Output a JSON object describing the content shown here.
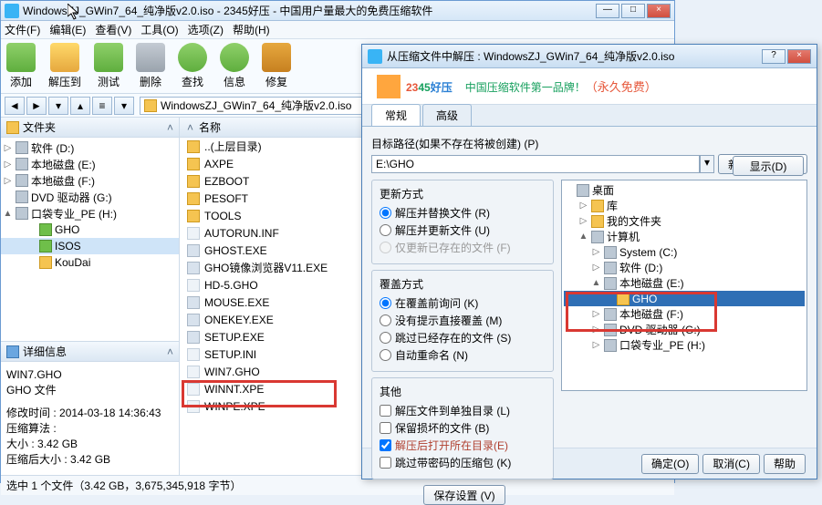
{
  "main": {
    "title": "WindowsZJ_GWin7_64_纯净版v2.0.iso - 2345好压 - 中国用户量最大的免费压缩软件",
    "menus": [
      "文件(F)",
      "编辑(E)",
      "查看(V)",
      "工具(O)",
      "选项(Z)",
      "帮助(H)"
    ],
    "toolbar": {
      "add": "添加",
      "extract": "解压到",
      "test": "测试",
      "del": "删除",
      "find": "查找",
      "info": "信息",
      "repair": "修复"
    },
    "navpath": "WindowsZJ_GWin7_64_纯净版v2.0.iso",
    "folderPane": "文件夹",
    "tree": [
      {
        "label": "软件 (D:)",
        "depth": 0,
        "exp": "▷",
        "ico": "drive"
      },
      {
        "label": "本地磁盘 (E:)",
        "depth": 0,
        "exp": "▷",
        "ico": "drive"
      },
      {
        "label": "本地磁盘 (F:)",
        "depth": 0,
        "exp": "▷",
        "ico": "drive"
      },
      {
        "label": "DVD 驱动器 (G:)",
        "depth": 0,
        "exp": "",
        "ico": "drive"
      },
      {
        "label": "口袋专业_PE (H:)",
        "depth": 0,
        "exp": "▲",
        "ico": "drive"
      },
      {
        "label": "GHO",
        "depth": 1,
        "exp": "",
        "ico": "folder g"
      },
      {
        "label": "ISOS",
        "depth": 1,
        "exp": "",
        "ico": "folder g",
        "sel": true
      },
      {
        "label": "KouDai",
        "depth": 1,
        "exp": "",
        "ico": "folder"
      }
    ],
    "detailPane": "详细信息",
    "detail": {
      "filename": "WIN7.GHO",
      "type": "GHO 文件",
      "mtime_label": "修改时间 : ",
      "mtime": "2014-03-18 14:36:43",
      "algo_label": "压缩算法 : ",
      "algo": "",
      "size_label": "大小 : ",
      "size": "3.42 GB",
      "packed_label": "压缩后大小 : ",
      "packed": "3.42 GB"
    },
    "listHeader": "名称",
    "files": [
      {
        "name": "..(上层目录)",
        "ico": "folder"
      },
      {
        "name": "AXPE",
        "ico": "folder"
      },
      {
        "name": "EZBOOT",
        "ico": "folder"
      },
      {
        "name": "PESOFT",
        "ico": "folder"
      },
      {
        "name": "TOOLS",
        "ico": "folder"
      },
      {
        "name": "AUTORUN.INF",
        "ico": "file"
      },
      {
        "name": "GHOST.EXE",
        "ico": "exe"
      },
      {
        "name": "GHO镜像浏览器V11.EXE",
        "ico": "exe"
      },
      {
        "name": "HD-5.GHO",
        "ico": "file"
      },
      {
        "name": "MOUSE.EXE",
        "ico": "exe"
      },
      {
        "name": "ONEKEY.EXE",
        "ico": "exe"
      },
      {
        "name": "SETUP.EXE",
        "ico": "exe"
      },
      {
        "name": "SETUP.INI",
        "ico": "file"
      },
      {
        "name": "WIN7.GHO",
        "ico": "file"
      },
      {
        "name": "WINNT.XPE",
        "ico": "file"
      },
      {
        "name": "WINPE.XPE",
        "ico": "file"
      }
    ],
    "status": "选中 1 个文件（3.42 GB，3,675,345,918 字节）"
  },
  "dlg": {
    "title": "从压缩文件中解压 : WindowsZJ_GWin7_64_纯净版v2.0.iso",
    "brand": {
      "b1": "23",
      "b2": "45",
      "b3": "好压"
    },
    "slogan": "中国压缩软件第一品牌！",
    "free": "（永久免费）",
    "tabs": {
      "general": "常规",
      "advanced": "高级"
    },
    "pathLabel": "目标路径(如果不存在将被创建) (P)",
    "pathValue": "E:\\GHO",
    "btnShow": "显示(D)",
    "btnNewFolder": "新建文件夹(E)",
    "grpUpdate": "更新方式",
    "updOpts": [
      {
        "t": "解压并替换文件 (R)",
        "type": "radio",
        "c": true
      },
      {
        "t": "解压并更新文件 (U)",
        "type": "radio",
        "c": false
      },
      {
        "t": "仅更新已存在的文件 (F)",
        "type": "radio",
        "c": false,
        "dis": true
      }
    ],
    "grpOverwrite": "覆盖方式",
    "ovOpts": [
      {
        "t": "在覆盖前询问 (K)",
        "c": true
      },
      {
        "t": "没有提示直接覆盖 (M)",
        "c": false
      },
      {
        "t": "跳过已经存在的文件 (S)",
        "c": false
      },
      {
        "t": "自动重命名 (N)",
        "c": false
      }
    ],
    "grpOther": "其他",
    "otOpts": [
      {
        "t": "解压文件到单独目录 (L)",
        "c": false
      },
      {
        "t": "保留损坏的文件 (B)",
        "c": false
      },
      {
        "t": "解压后打开所在目录(E)",
        "c": true,
        "hl": true
      },
      {
        "t": "跳过带密码的压缩包 (K)",
        "c": false
      }
    ],
    "btnSaveCfg": "保存设置 (V)",
    "tree": [
      {
        "label": "桌面",
        "d": 0,
        "exp": "",
        "ico": "drive"
      },
      {
        "label": "库",
        "d": 1,
        "exp": "▷",
        "ico": "folder"
      },
      {
        "label": "我的文件夹",
        "d": 1,
        "exp": "▷",
        "ico": "folder"
      },
      {
        "label": "计算机",
        "d": 1,
        "exp": "▲",
        "ico": "drive"
      },
      {
        "label": "System (C:)",
        "d": 2,
        "exp": "▷",
        "ico": "drive"
      },
      {
        "label": "软件 (D:)",
        "d": 2,
        "exp": "▷",
        "ico": "drive"
      },
      {
        "label": "本地磁盘 (E:)",
        "d": 2,
        "exp": "▲",
        "ico": "drive"
      },
      {
        "label": "GHO",
        "d": 3,
        "exp": "",
        "ico": "folder",
        "sel": true
      },
      {
        "label": "本地磁盘 (F:)",
        "d": 2,
        "exp": "▷",
        "ico": "drive"
      },
      {
        "label": "DVD 驱动器 (G:)",
        "d": 2,
        "exp": "▷",
        "ico": "drive"
      },
      {
        "label": "口袋专业_PE (H:)",
        "d": 2,
        "exp": "▷",
        "ico": "drive"
      }
    ],
    "btnOk": "确定(O)",
    "btnCancel": "取消(C)",
    "btnHelp": "帮助"
  }
}
